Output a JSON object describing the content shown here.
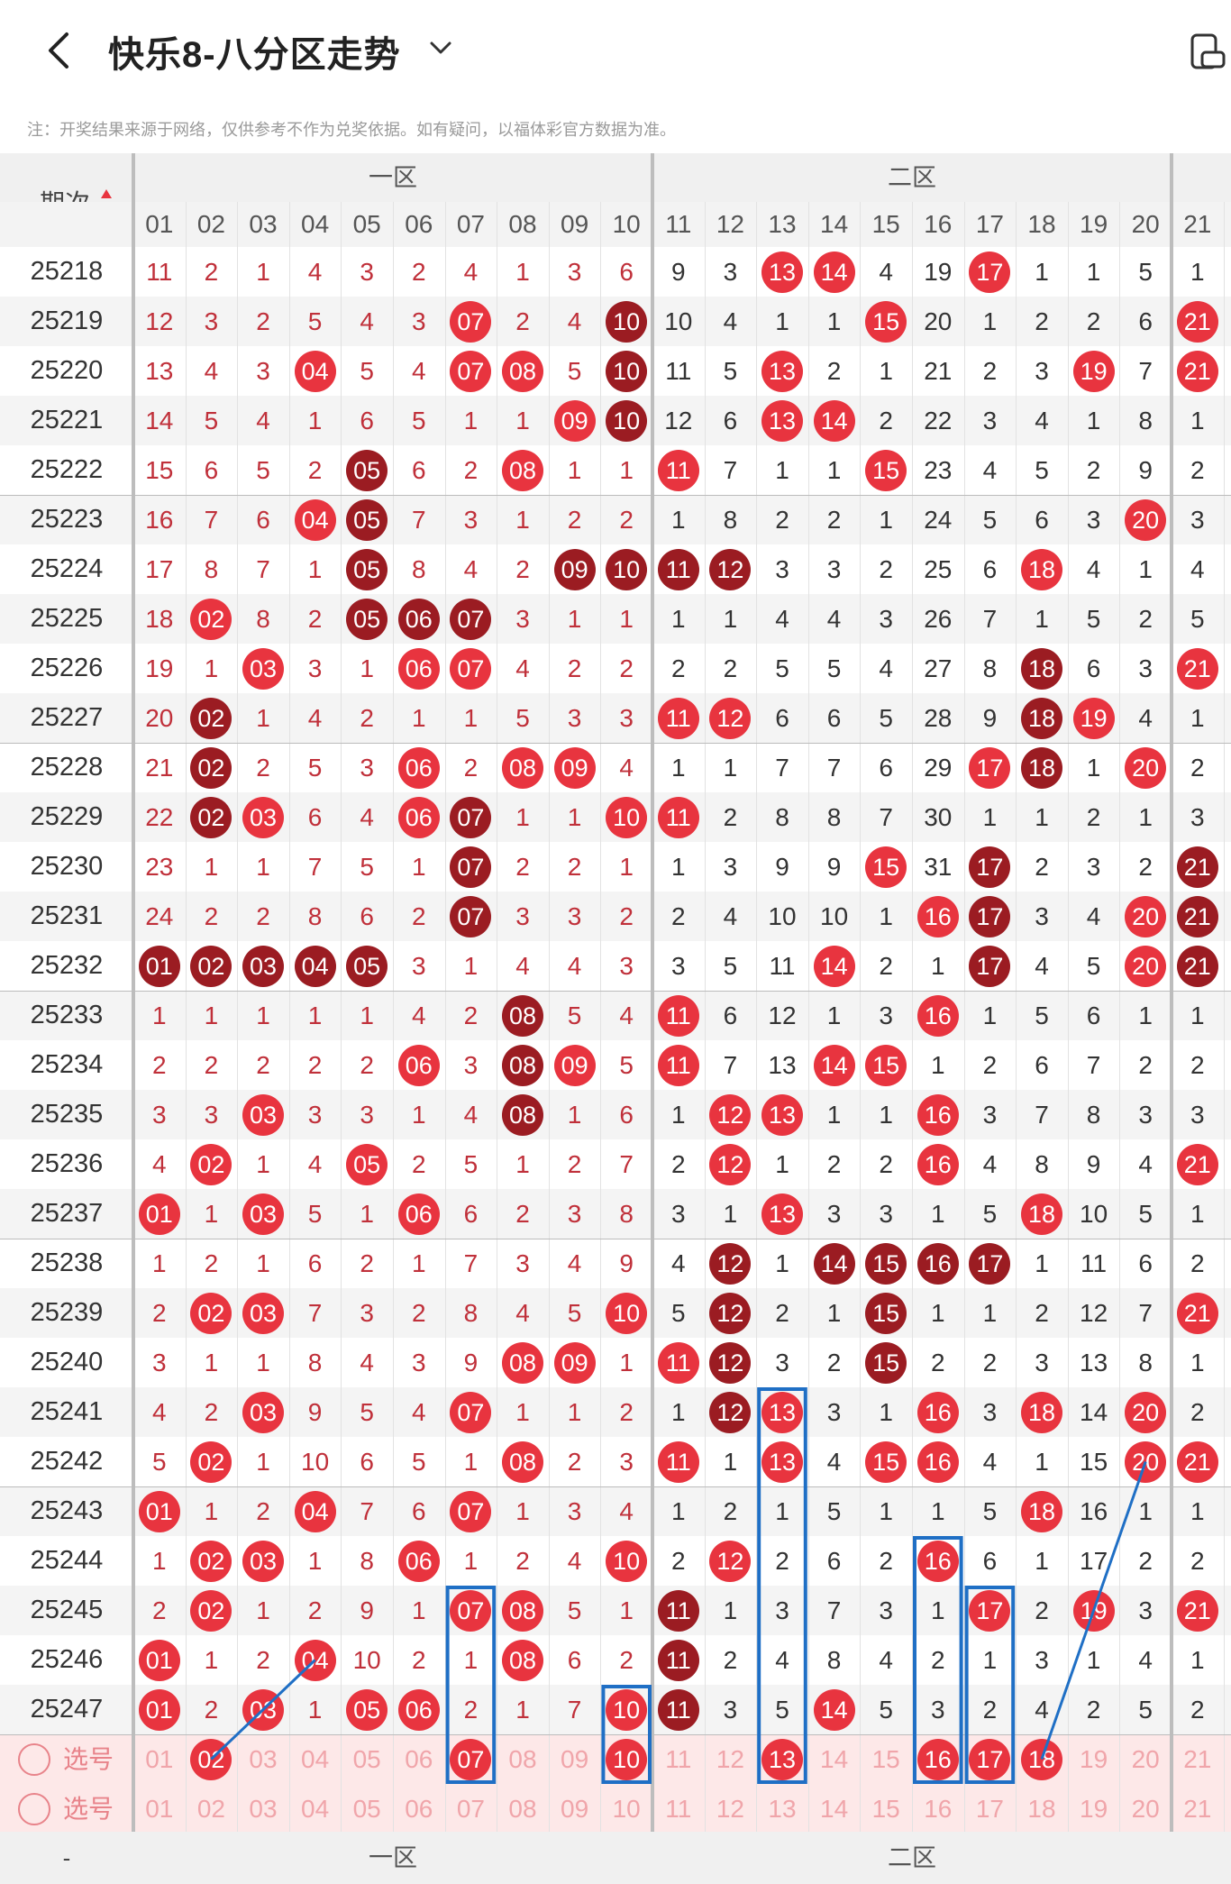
{
  "header": {
    "title": "快乐8-八分区走势",
    "note": "注：开奖结果来源于网络，仅供参考不作为兑奖依据。如有疑问，以福体彩官方数据为准。"
  },
  "table": {
    "period_label": "期次",
    "zone1_label": "一区",
    "zone2_label": "二区",
    "columns": [
      "01",
      "02",
      "03",
      "04",
      "05",
      "06",
      "07",
      "08",
      "09",
      "10",
      "11",
      "12",
      "13",
      "14",
      "15",
      "16",
      "17",
      "18",
      "19",
      "20",
      "21"
    ],
    "rows": [
      {
        "period": "25218",
        "cells": [
          "11",
          "2",
          "1",
          "4",
          "3",
          "2",
          "4",
          "1",
          "3",
          "6",
          "9",
          "3",
          "13",
          "14",
          "4",
          "19",
          "17",
          "1",
          "1",
          "5",
          "1"
        ],
        "balls": {
          "13": "red",
          "14": "red",
          "17": "red"
        }
      },
      {
        "period": "25219",
        "cells": [
          "12",
          "3",
          "2",
          "5",
          "4",
          "3",
          "07",
          "2",
          "4",
          "10",
          "10",
          "4",
          "1",
          "1",
          "15",
          "20",
          "1",
          "2",
          "2",
          "6",
          "21"
        ],
        "balls": {
          "07": "red",
          "10": "dark",
          "15": "red",
          "21": "red"
        }
      },
      {
        "period": "25220",
        "cells": [
          "13",
          "4",
          "3",
          "04",
          "5",
          "4",
          "07",
          "08",
          "5",
          "10",
          "11",
          "5",
          "13",
          "2",
          "1",
          "21",
          "2",
          "3",
          "19",
          "7",
          "21"
        ],
        "balls": {
          "04": "red",
          "07": "red",
          "08": "red",
          "10": "dark",
          "13": "red",
          "19": "red",
          "21": "red"
        }
      },
      {
        "period": "25221",
        "cells": [
          "14",
          "5",
          "4",
          "1",
          "6",
          "5",
          "1",
          "1",
          "09",
          "10",
          "12",
          "6",
          "13",
          "14",
          "2",
          "22",
          "3",
          "4",
          "1",
          "8",
          "1"
        ],
        "balls": {
          "09": "red",
          "10": "dark",
          "13": "red",
          "14": "red"
        }
      },
      {
        "period": "25222",
        "cells": [
          "15",
          "6",
          "5",
          "2",
          "05",
          "6",
          "2",
          "08",
          "1",
          "1",
          "11",
          "7",
          "1",
          "1",
          "15",
          "23",
          "4",
          "5",
          "2",
          "9",
          "2"
        ],
        "balls": {
          "05": "dark",
          "08": "red",
          "11": "red",
          "15": "red"
        }
      },
      {
        "period": "25223",
        "cells": [
          "16",
          "7",
          "6",
          "04",
          "05",
          "7",
          "3",
          "1",
          "2",
          "2",
          "1",
          "8",
          "2",
          "2",
          "1",
          "24",
          "5",
          "6",
          "3",
          "20",
          "3"
        ],
        "balls": {
          "04": "red",
          "05": "dark",
          "20": "red"
        }
      },
      {
        "period": "25224",
        "cells": [
          "17",
          "8",
          "7",
          "1",
          "05",
          "8",
          "4",
          "2",
          "09",
          "10",
          "11",
          "12",
          "3",
          "3",
          "2",
          "25",
          "6",
          "18",
          "4",
          "1",
          "4"
        ],
        "balls": {
          "05": "dark",
          "09": "dark",
          "10": "dark",
          "11": "dark",
          "12": "dark",
          "18": "red"
        }
      },
      {
        "period": "25225",
        "cells": [
          "18",
          "02",
          "8",
          "2",
          "05",
          "06",
          "07",
          "3",
          "1",
          "1",
          "1",
          "1",
          "4",
          "4",
          "3",
          "26",
          "7",
          "1",
          "5",
          "2",
          "5"
        ],
        "balls": {
          "02": "red",
          "05": "dark",
          "06": "dark",
          "07": "dark"
        }
      },
      {
        "period": "25226",
        "cells": [
          "19",
          "1",
          "03",
          "3",
          "1",
          "06",
          "07",
          "4",
          "2",
          "2",
          "2",
          "2",
          "5",
          "5",
          "4",
          "27",
          "8",
          "18",
          "6",
          "3",
          "21"
        ],
        "balls": {
          "03": "red",
          "06": "red",
          "07": "red",
          "18": "dark",
          "21": "red"
        }
      },
      {
        "period": "25227",
        "cells": [
          "20",
          "02",
          "1",
          "4",
          "2",
          "1",
          "1",
          "5",
          "3",
          "3",
          "11",
          "12",
          "6",
          "6",
          "5",
          "28",
          "9",
          "18",
          "19",
          "4",
          "1"
        ],
        "balls": {
          "02": "dark",
          "11": "red",
          "12": "red",
          "18": "dark",
          "19": "red"
        }
      },
      {
        "period": "25228",
        "cells": [
          "21",
          "02",
          "2",
          "5",
          "3",
          "06",
          "2",
          "08",
          "09",
          "4",
          "1",
          "1",
          "7",
          "7",
          "6",
          "29",
          "17",
          "18",
          "1",
          "20",
          "2"
        ],
        "balls": {
          "02": "dark",
          "06": "red",
          "08": "red",
          "09": "red",
          "17": "red",
          "18": "dark",
          "20": "red"
        }
      },
      {
        "period": "25229",
        "cells": [
          "22",
          "02",
          "03",
          "6",
          "4",
          "06",
          "07",
          "1",
          "1",
          "10",
          "11",
          "2",
          "8",
          "8",
          "7",
          "30",
          "1",
          "1",
          "2",
          "1",
          "3"
        ],
        "balls": {
          "02": "dark",
          "03": "red",
          "06": "red",
          "07": "dark",
          "10": "red",
          "11": "red"
        }
      },
      {
        "period": "25230",
        "cells": [
          "23",
          "1",
          "1",
          "7",
          "5",
          "1",
          "07",
          "2",
          "2",
          "1",
          "1",
          "3",
          "9",
          "9",
          "15",
          "31",
          "17",
          "2",
          "3",
          "2",
          "21"
        ],
        "balls": {
          "07": "dark",
          "15": "red",
          "17": "dark",
          "21": "dark"
        }
      },
      {
        "period": "25231",
        "cells": [
          "24",
          "2",
          "2",
          "8",
          "6",
          "2",
          "07",
          "3",
          "3",
          "2",
          "2",
          "4",
          "10",
          "10",
          "1",
          "16",
          "17",
          "3",
          "4",
          "20",
          "21"
        ],
        "balls": {
          "07": "dark",
          "16": "red",
          "17": "dark",
          "20": "red",
          "21": "dark"
        }
      },
      {
        "period": "25232",
        "cells": [
          "01",
          "02",
          "03",
          "04",
          "05",
          "3",
          "1",
          "4",
          "4",
          "3",
          "3",
          "5",
          "11",
          "14",
          "2",
          "1",
          "17",
          "4",
          "5",
          "20",
          "21"
        ],
        "balls": {
          "01": "dark",
          "02": "dark",
          "03": "dark",
          "04": "dark",
          "05": "dark",
          "14": "red",
          "17": "dark",
          "20": "red",
          "21": "dark"
        }
      },
      {
        "period": "25233",
        "cells": [
          "1",
          "1",
          "1",
          "1",
          "1",
          "4",
          "2",
          "08",
          "5",
          "4",
          "11",
          "6",
          "12",
          "1",
          "3",
          "16",
          "1",
          "5",
          "6",
          "1",
          "1"
        ],
        "balls": {
          "08": "dark",
          "11": "red",
          "16": "red"
        }
      },
      {
        "period": "25234",
        "cells": [
          "2",
          "2",
          "2",
          "2",
          "2",
          "06",
          "3",
          "08",
          "09",
          "5",
          "11",
          "7",
          "13",
          "14",
          "15",
          "1",
          "2",
          "6",
          "7",
          "2",
          "2"
        ],
        "balls": {
          "06": "red",
          "08": "dark",
          "09": "red",
          "11": "red",
          "14": "red",
          "15": "red"
        }
      },
      {
        "period": "25235",
        "cells": [
          "3",
          "3",
          "03",
          "3",
          "3",
          "1",
          "4",
          "08",
          "1",
          "6",
          "1",
          "12",
          "13",
          "1",
          "1",
          "16",
          "3",
          "7",
          "8",
          "3",
          "3"
        ],
        "balls": {
          "03": "red",
          "08": "dark",
          "12": "red",
          "13": "red",
          "16": "red"
        }
      },
      {
        "period": "25236",
        "cells": [
          "4",
          "02",
          "1",
          "4",
          "05",
          "2",
          "5",
          "1",
          "2",
          "7",
          "2",
          "12",
          "1",
          "2",
          "2",
          "16",
          "4",
          "8",
          "9",
          "4",
          "21"
        ],
        "balls": {
          "02": "red",
          "05": "red",
          "12": "red",
          "16": "red",
          "21": "red"
        }
      },
      {
        "period": "25237",
        "cells": [
          "01",
          "1",
          "03",
          "5",
          "1",
          "06",
          "6",
          "2",
          "3",
          "8",
          "3",
          "1",
          "13",
          "3",
          "3",
          "1",
          "5",
          "18",
          "10",
          "5",
          "1"
        ],
        "balls": {
          "01": "red",
          "03": "red",
          "06": "red",
          "13": "red",
          "18": "red"
        }
      },
      {
        "period": "25238",
        "cells": [
          "1",
          "2",
          "1",
          "6",
          "2",
          "1",
          "7",
          "3",
          "4",
          "9",
          "4",
          "12",
          "1",
          "14",
          "15",
          "16",
          "17",
          "1",
          "11",
          "6",
          "2"
        ],
        "balls": {
          "12": "dark",
          "14": "dark",
          "15": "dark",
          "16": "dark",
          "17": "dark"
        }
      },
      {
        "period": "25239",
        "cells": [
          "2",
          "02",
          "03",
          "7",
          "3",
          "2",
          "8",
          "4",
          "5",
          "10",
          "5",
          "12",
          "2",
          "1",
          "15",
          "1",
          "1",
          "2",
          "12",
          "7",
          "21"
        ],
        "balls": {
          "02": "red",
          "03": "red",
          "10": "red",
          "12": "dark",
          "15": "dark",
          "21": "red"
        }
      },
      {
        "period": "25240",
        "cells": [
          "3",
          "1",
          "1",
          "8",
          "4",
          "3",
          "9",
          "08",
          "09",
          "1",
          "11",
          "12",
          "3",
          "2",
          "15",
          "2",
          "2",
          "3",
          "13",
          "8",
          "1"
        ],
        "balls": {
          "08": "red",
          "09": "red",
          "11": "red",
          "12": "dark",
          "15": "dark"
        }
      },
      {
        "period": "25241",
        "cells": [
          "4",
          "2",
          "03",
          "9",
          "5",
          "4",
          "07",
          "1",
          "1",
          "2",
          "1",
          "12",
          "13",
          "3",
          "1",
          "16",
          "3",
          "18",
          "14",
          "20",
          "2"
        ],
        "balls": {
          "03": "red",
          "07": "red",
          "12": "dark",
          "13": "red",
          "16": "red",
          "18": "red",
          "20": "red"
        }
      },
      {
        "period": "25242",
        "cells": [
          "5",
          "02",
          "1",
          "10",
          "6",
          "5",
          "1",
          "08",
          "2",
          "3",
          "11",
          "1",
          "13",
          "4",
          "15",
          "16",
          "4",
          "1",
          "15",
          "20",
          "21"
        ],
        "balls": {
          "02": "red",
          "08": "red",
          "11": "red",
          "13": "red",
          "15": "red",
          "16": "red",
          "20": "red",
          "21": "red"
        }
      },
      {
        "period": "25243",
        "cells": [
          "01",
          "1",
          "2",
          "04",
          "7",
          "6",
          "07",
          "1",
          "3",
          "4",
          "1",
          "2",
          "1",
          "5",
          "1",
          "1",
          "5",
          "18",
          "16",
          "1",
          "1"
        ],
        "balls": {
          "01": "red",
          "04": "red",
          "07": "red",
          "18": "red"
        }
      },
      {
        "period": "25244",
        "cells": [
          "1",
          "02",
          "03",
          "1",
          "8",
          "06",
          "1",
          "2",
          "4",
          "10",
          "2",
          "12",
          "2",
          "6",
          "2",
          "16",
          "6",
          "1",
          "17",
          "2",
          "2"
        ],
        "balls": {
          "02": "red",
          "03": "red",
          "06": "red",
          "10": "red",
          "12": "red",
          "16": "red"
        }
      },
      {
        "period": "25245",
        "cells": [
          "2",
          "02",
          "1",
          "2",
          "9",
          "1",
          "07",
          "08",
          "5",
          "1",
          "11",
          "1",
          "3",
          "7",
          "3",
          "1",
          "17",
          "2",
          "19",
          "3",
          "21"
        ],
        "balls": {
          "02": "red",
          "07": "red",
          "08": "red",
          "11": "dark",
          "17": "red",
          "19": "red",
          "21": "red"
        }
      },
      {
        "period": "25246",
        "cells": [
          "01",
          "1",
          "2",
          "04",
          "10",
          "2",
          "1",
          "08",
          "6",
          "2",
          "11",
          "2",
          "4",
          "8",
          "4",
          "2",
          "1",
          "3",
          "1",
          "4",
          "1"
        ],
        "balls": {
          "01": "red",
          "04": "red",
          "08": "red",
          "11": "dark"
        }
      },
      {
        "period": "25247",
        "cells": [
          "01",
          "2",
          "03",
          "1",
          "05",
          "06",
          "2",
          "1",
          "7",
          "10",
          "11",
          "3",
          "5",
          "14",
          "5",
          "3",
          "2",
          "4",
          "2",
          "5",
          "2"
        ],
        "balls": {
          "01": "red",
          "03": "red",
          "05": "red",
          "06": "red",
          "10": "red",
          "11": "dark",
          "14": "red"
        }
      }
    ],
    "select_label": "选号",
    "select_row1_picked": {
      "02": "pick",
      "07": "pick",
      "10": "pick",
      "13": "pick",
      "16": "pick",
      "17": "pick",
      "18": "pick"
    },
    "footer_zone1": "一区",
    "footer_zone2": "二区"
  },
  "colors": {
    "ball_red": "#e8343f",
    "ball_dark": "#9b1c22",
    "annotation_blue": "#1f6fc5"
  }
}
